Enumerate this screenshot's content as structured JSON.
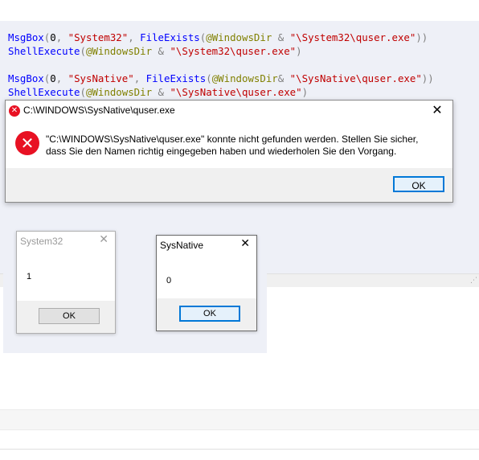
{
  "code": {
    "line1": {
      "fn": "MsgBox",
      "open": "(",
      "num": "0",
      "comma1": ", ",
      "str1": "\"System32\"",
      "comma2": ", ",
      "fn2": "FileExists",
      "open2": "(",
      "mac": "@WindowsDir",
      "amp": " & ",
      "str2": "\"\\System32\\quser.exe\"",
      "close": "))"
    },
    "line2": {
      "fn": "ShellExecute",
      "open": "(",
      "mac": "@WindowsDir",
      "amp": " & ",
      "str": "\"\\System32\\quser.exe\"",
      "close": ")"
    },
    "line3": {
      "fn": "MsgBox",
      "open": "(",
      "num": "0",
      "comma1": ", ",
      "str1": "\"SysNative\"",
      "comma2": ", ",
      "fn2": "FileExists",
      "open2": "(",
      "mac": "@WindowsDir",
      "amp": "& ",
      "str2": "\"\\SysNative\\quser.exe\"",
      "close": "))"
    },
    "line4": {
      "fn": "ShellExecute",
      "open": "(",
      "mac": "@WindowsDir",
      "amp": " & ",
      "str": "\"\\SysNative\\quser.exe\"",
      "close": ")"
    }
  },
  "error_dialog": {
    "title": "C:\\WINDOWS\\SysNative\\quser.exe",
    "message": "\"C:\\WINDOWS\\SysNative\\quser.exe\" konnte nicht gefunden werden. Stellen Sie sicher, dass Sie den Namen richtig eingegeben haben und wiederholen Sie den Vorgang.",
    "ok_label": "OK",
    "close_glyph": "✕",
    "icon": "error-icon"
  },
  "dialog_system32": {
    "title": "System32",
    "value": "1",
    "ok_label": "OK",
    "close_glyph": "✕"
  },
  "dialog_sysnative": {
    "title": "SysNative",
    "value": "0",
    "ok_label": "OK",
    "close_glyph": "✕"
  },
  "colors": {
    "keyword": "#0000ff",
    "string": "#c00000",
    "macro": "#808000",
    "error": "#e81123",
    "accent": "#0078d7"
  }
}
